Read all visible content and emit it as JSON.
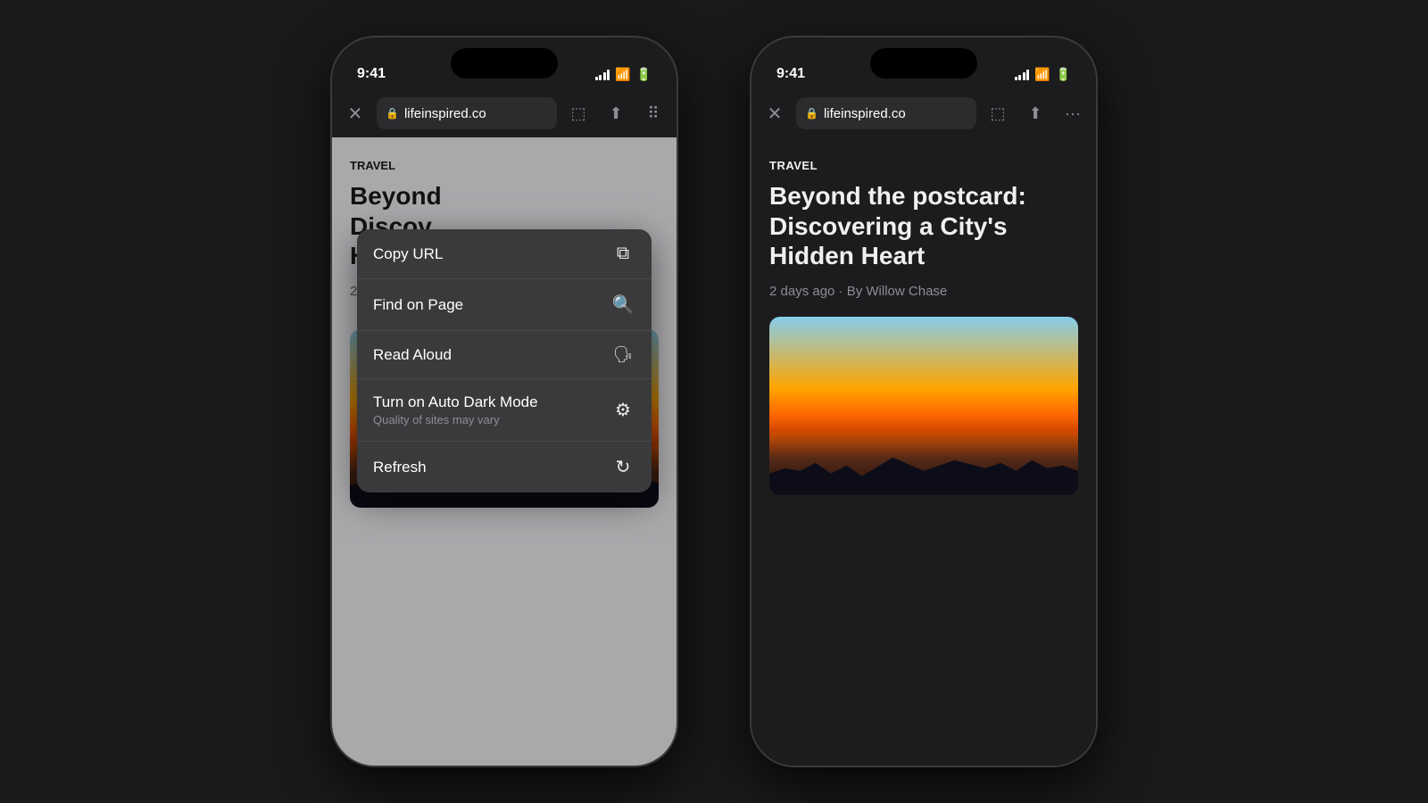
{
  "page": {
    "background": "#1a1a1a"
  },
  "left_phone": {
    "status": {
      "time": "9:41",
      "signal": "signal-bars",
      "wifi": "wifi",
      "battery": "battery"
    },
    "address_bar": {
      "close_label": "×",
      "lock_icon": "🔒",
      "url": "lifeinspired.co",
      "bookmark_icon": "bookmark",
      "share_icon": "share",
      "more_icon": "more"
    },
    "content": {
      "category": "TRAVEL",
      "title_partial": "Beyond\nDiscov\nHidden",
      "meta": "2 days ago"
    },
    "context_menu": {
      "items": [
        {
          "label": "Copy URL",
          "sublabel": "",
          "icon": "⧉"
        },
        {
          "label": "Find on Page",
          "sublabel": "",
          "icon": "⌕"
        },
        {
          "label": "Read Aloud",
          "sublabel": "",
          "icon": "👤"
        },
        {
          "label": "Turn on Auto Dark Mode",
          "sublabel": "Quality of sites may vary",
          "icon": "⚙"
        },
        {
          "label": "Refresh",
          "sublabel": "",
          "icon": "↻"
        }
      ]
    }
  },
  "right_phone": {
    "status": {
      "time": "9:41",
      "signal": "signal-bars",
      "wifi": "wifi",
      "battery": "battery"
    },
    "address_bar": {
      "close_label": "×",
      "lock_icon": "🔒",
      "url": "lifeinspired.co",
      "bookmark_icon": "bookmark",
      "share_icon": "share",
      "more_icon": "more"
    },
    "content": {
      "category": "TRAVEL",
      "title": "Beyond the postcard: Discovering a City's Hidden Heart",
      "meta": "2 days ago · By Willow Chase"
    }
  }
}
